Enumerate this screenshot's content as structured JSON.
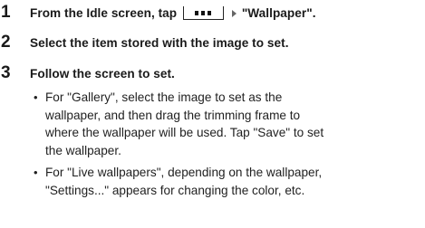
{
  "steps": [
    {
      "number": "1",
      "text_before": "From the Idle screen, tap",
      "menu_key_icon": "menu-key-icon",
      "arrow_icon": "right-triangle-icon",
      "text_after": "\"Wallpaper\"."
    },
    {
      "number": "2",
      "text": "Select the item stored with the image to set."
    },
    {
      "number": "3",
      "text": "Follow the screen to set."
    }
  ],
  "bullets": [
    {
      "symbol": "•",
      "lines": [
        "For \"Gallery\", select the image to set as the",
        "wallpaper, and then drag the trimming frame to",
        "where the wallpaper will be used. Tap \"Save\" to set",
        "the wallpaper."
      ]
    },
    {
      "symbol": "•",
      "lines": [
        "For \"Live wallpapers\", depending on the wallpaper,",
        "\"Settings...\" appears for changing the color, etc."
      ]
    }
  ]
}
